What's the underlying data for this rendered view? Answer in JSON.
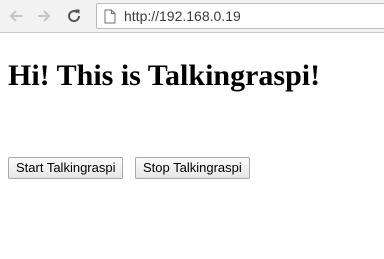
{
  "browser": {
    "url": "http://192.168.0.19",
    "icons": {
      "back": "arrow-left-icon",
      "forward": "arrow-right-icon",
      "reload": "reload-icon",
      "page": "page-icon"
    }
  },
  "page": {
    "heading": "Hi! This is Talkingraspi!",
    "buttons": {
      "start_label": "Start Talkingraspi",
      "stop_label": "Stop Talkingraspi"
    }
  }
}
